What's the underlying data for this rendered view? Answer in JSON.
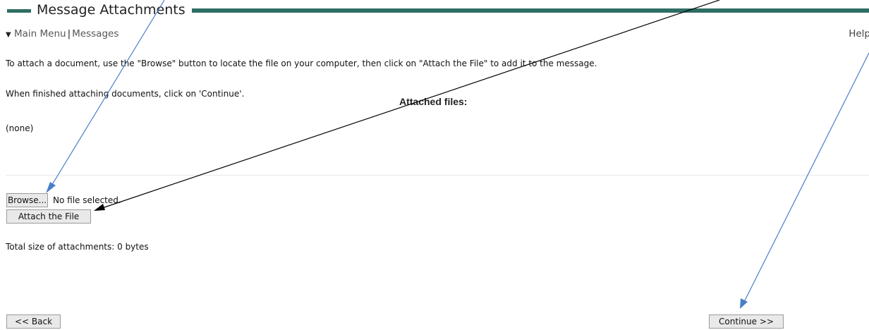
{
  "page": {
    "title": "Message Attachments"
  },
  "nav": {
    "triangle": "▼",
    "main_menu": "Main Menu",
    "separator": "|",
    "messages": "Messages",
    "help": "Help"
  },
  "instructions": {
    "line1": "To attach a document, use the \"Browse\" button to locate the file on your computer, then click on \"Attach the File\" to add it to the message.",
    "line2": "When finished attaching documents, click on 'Continue'."
  },
  "attached": {
    "heading": "Attached files:",
    "list_text": "(none)"
  },
  "file_input": {
    "browse_label": "Browse...",
    "status": "No file selected."
  },
  "attach_button": "Attach the File",
  "total_size": "Total size of attachments: 0 bytes",
  "back_button": "<< Back",
  "continue_button": "Continue >>",
  "colors": {
    "title_rule": "#2e6e63",
    "arrow_blue": "#4a7fc8",
    "arrow_black": "#000000"
  }
}
